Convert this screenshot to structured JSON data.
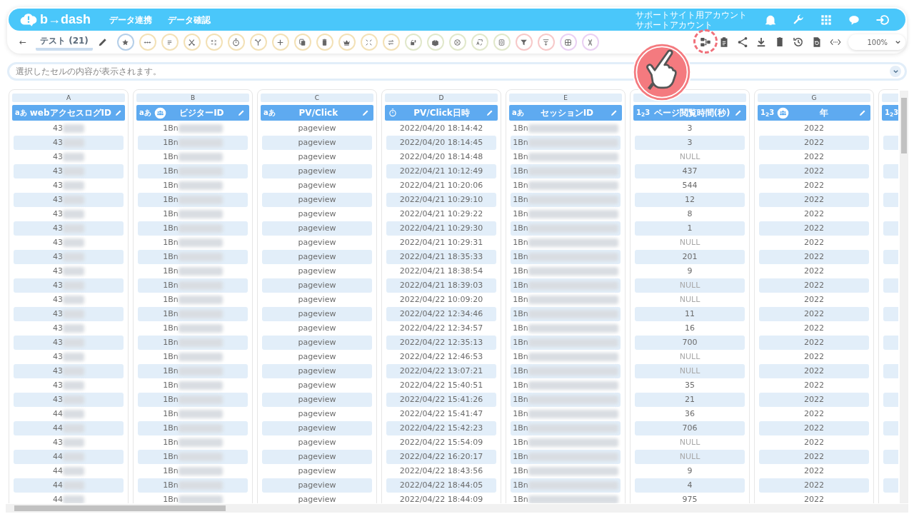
{
  "header": {
    "logo": "b→dash",
    "nav": [
      "データ連携",
      "データ確認"
    ],
    "account": [
      "サポートサイト用アカウント",
      "サポートアカウント"
    ]
  },
  "toolbar": {
    "back": "←",
    "tab": {
      "label": "テスト (21)",
      "selected": true
    },
    "tools": [
      {
        "kind": "star",
        "color": "#b5cfe9"
      },
      {
        "kind": "dots",
        "color": "#f3e1b6"
      },
      {
        "kind": "lines",
        "color": "#f3e1b6"
      },
      {
        "kind": "scissors",
        "color": "#f3e1b6"
      },
      {
        "kind": "calculator",
        "color": "#f3e1b6"
      },
      {
        "kind": "stopwatch",
        "color": "#f3e1b6"
      },
      {
        "kind": "branch",
        "color": "#f3e1b6"
      },
      {
        "kind": "plus",
        "color": "#f3e1b6"
      },
      {
        "kind": "copy",
        "color": "#f3e1b6"
      },
      {
        "kind": "trash",
        "color": "#f3e1b6"
      },
      {
        "kind": "crown",
        "color": "#f3e1b6"
      },
      {
        "kind": "compress",
        "color": "#f3e1b6"
      },
      {
        "kind": "swap",
        "color": "#f3e1b6"
      },
      {
        "kind": "lock",
        "color": "#e1e8cb"
      },
      {
        "kind": "box",
        "color": "#e1e8cb"
      },
      {
        "kind": "close",
        "color": "#e1e8cb"
      },
      {
        "kind": "translate",
        "color": "#e1e8cb"
      },
      {
        "kind": "zero",
        "color": "#e1e8cb"
      },
      {
        "kind": "filter",
        "color": "#f7c9c9"
      },
      {
        "kind": "sort",
        "color": "#f7c9c9"
      },
      {
        "kind": "table",
        "color": "#ead0f3"
      },
      {
        "kind": "dna",
        "color": "#ead0f3"
      }
    ],
    "actions": [
      {
        "kind": "flow",
        "highlighted": true
      },
      {
        "kind": "clipboard",
        "highlighted": false
      },
      {
        "kind": "share",
        "highlighted": false
      },
      {
        "kind": "download",
        "highlighted": false
      },
      {
        "kind": "trash",
        "highlighted": false
      },
      {
        "kind": "history",
        "highlighted": false
      },
      {
        "kind": "file-refresh",
        "highlighted": false
      },
      {
        "kind": "code",
        "highlighted": false
      }
    ],
    "zoom": "100%"
  },
  "cell_bar": {
    "placeholder": "選択したセルの内容が表示されます。"
  },
  "columns": [
    {
      "index": "A",
      "name": "webアクセスログID",
      "kind": "glyph",
      "type_glyph": "aあ",
      "key": false,
      "redacted": true,
      "cells": [
        "43",
        "43",
        "43",
        "43",
        "43",
        "43",
        "43",
        "43",
        "43",
        "43",
        "43",
        "43",
        "43",
        "43",
        "43",
        "43",
        "43",
        "43",
        "43",
        "43",
        "44",
        "44",
        "43",
        "44",
        "44",
        "44",
        "44"
      ]
    },
    {
      "index": "B",
      "name": "ビジターID",
      "kind": "glyph",
      "type_glyph": "aあ",
      "key": true,
      "redacted": true,
      "cells": [
        "1Bn",
        "1Bn",
        "1Bn",
        "1Bn",
        "1Bn",
        "1Bn",
        "1Bn",
        "1Bn",
        "1Bn",
        "1Bn",
        "1Bn",
        "1Bn",
        "1Bn",
        "1Bn",
        "1Bn",
        "1Bn",
        "1Bn",
        "1Bn",
        "1Bn",
        "1Bn",
        "1Bn",
        "1Bn",
        "1Bn",
        "1Bn",
        "1Bn",
        "1Bn",
        "1Bn"
      ]
    },
    {
      "index": "C",
      "name": "PV/Click",
      "kind": "glyph",
      "type_glyph": "aあ",
      "key": false,
      "redacted": false,
      "cells": [
        "pageview",
        "pageview",
        "pageview",
        "pageview",
        "pageview",
        "pageview",
        "pageview",
        "pageview",
        "pageview",
        "pageview",
        "pageview",
        "pageview",
        "pageview",
        "pageview",
        "pageview",
        "pageview",
        "pageview",
        "pageview",
        "pageview",
        "pageview",
        "pageview",
        "pageview",
        "pageview",
        "pageview",
        "pageview",
        "pageview",
        "pageview"
      ]
    },
    {
      "index": "D",
      "name": "PV/Click日時",
      "kind": "clock",
      "key": false,
      "redacted": false,
      "cells": [
        "2022/04/20 18:14:42",
        "2022/04/20 18:14:45",
        "2022/04/20 18:14:48",
        "2022/04/21 10:12:49",
        "2022/04/21 10:20:06",
        "2022/04/21 10:29:10",
        "2022/04/21 10:29:22",
        "2022/04/21 10:29:30",
        "2022/04/21 10:29:31",
        "2022/04/21 18:35:33",
        "2022/04/21 18:38:54",
        "2022/04/21 18:39:03",
        "2022/04/22 10:09:20",
        "2022/04/22 12:34:46",
        "2022/04/22 12:34:57",
        "2022/04/22 12:35:13",
        "2022/04/22 12:46:53",
        "2022/04/22 13:07:21",
        "2022/04/22 15:40:51",
        "2022/04/22 15:41:26",
        "2022/04/22 15:41:47",
        "2022/04/22 15:42:23",
        "2022/04/22 15:54:09",
        "2022/04/22 16:20:17",
        "2022/04/22 18:43:56",
        "2022/04/22 18:44:05",
        "2022/04/22 18:44:09"
      ]
    },
    {
      "index": "E",
      "name": "セッションID",
      "kind": "glyph",
      "type_glyph": "aあ",
      "key": false,
      "redacted": true,
      "cells": [
        "1Bn",
        "1Bn",
        "1Bn",
        "1Bn",
        "1Bn",
        "1Bn",
        "1Bn",
        "1Bn",
        "1Bn",
        "1Bn",
        "1Bn",
        "1Bn",
        "1Bn",
        "1Bn",
        "1Bn",
        "1Bn",
        "1Bn",
        "1Bn",
        "1Bn",
        "1Bn",
        "1Bn",
        "1Bn",
        "1Bn",
        "1Bn",
        "1Bn",
        "1Bn",
        "1Bn"
      ]
    },
    {
      "name": "ページ閲覧時間(秒)",
      "kind": "glyph",
      "type_glyph": "1$_{2}$3",
      "key": false,
      "redacted": false,
      "cells": [
        "3",
        "3",
        "NULL",
        "437",
        "544",
        "12",
        "8",
        "1",
        "NULL",
        "201",
        "9",
        "NULL",
        "NULL",
        "11",
        "16",
        "700",
        "NULL",
        "NULL",
        "35",
        "21",
        "36",
        "706",
        "NULL",
        "NULL",
        "9",
        "4",
        "975"
      ]
    },
    {
      "index": "G",
      "name": "年",
      "kind": "glyph",
      "type_glyph": "1$_{2}$3",
      "key": true,
      "redacted": false,
      "cells": [
        "2022",
        "2022",
        "2022",
        "2022",
        "2022",
        "2022",
        "2022",
        "2022",
        "2022",
        "2022",
        "2022",
        "2022",
        "2022",
        "2022",
        "2022",
        "2022",
        "2022",
        "2022",
        "2022",
        "2022",
        "2022",
        "2022",
        "2022",
        "2022",
        "2022",
        "2022",
        "2022"
      ]
    },
    {
      "kind": "glyph",
      "type_glyph": "1$_{2}$3"
    }
  ]
}
